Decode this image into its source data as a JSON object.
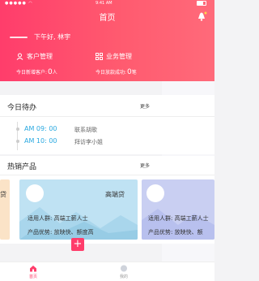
{
  "status_bar": {
    "time": "9:41 AM",
    "signal": "●●●●● ◠"
  },
  "header": {
    "title": "首页",
    "greeting": "下午好, 林宇",
    "customer_mgmt": "客户管理",
    "business_mgmt": "业务管理",
    "new_customers_label": "今日新增客户:",
    "new_customers_value": "0",
    "new_customers_unit": "人",
    "deals_label": "今日放款成功:",
    "deals_value": "0",
    "deals_unit": "笔"
  },
  "today": {
    "title": "今日待办",
    "more": "更多",
    "items": [
      {
        "time": "AM 09: 00",
        "text": "联系胡歌"
      },
      {
        "time": "AM 10: 00",
        "text": "拜访李小姐"
      }
    ]
  },
  "hot": {
    "title": "热销产品",
    "more": "更多",
    "left_card_title": "贷",
    "cards": [
      {
        "name": "高端贷",
        "audience": "适用人群: 高端工薪人士",
        "advantage": "产品优势: 放映快、额度高"
      },
      {
        "name": "",
        "audience": "适用人群: 高端工薪人士",
        "advantage": "产品优势: 放映快、额"
      }
    ]
  },
  "tabs": [
    {
      "label": "首页"
    },
    {
      "label": "+"
    },
    {
      "label": "我的"
    }
  ],
  "colors": {
    "accent": "#ff3d6b",
    "timeline": "#2aa9e0",
    "card_bg": "#bfe2f3",
    "card_bg_alt": "#c9cff2",
    "card_left": "#fbe3c7"
  }
}
